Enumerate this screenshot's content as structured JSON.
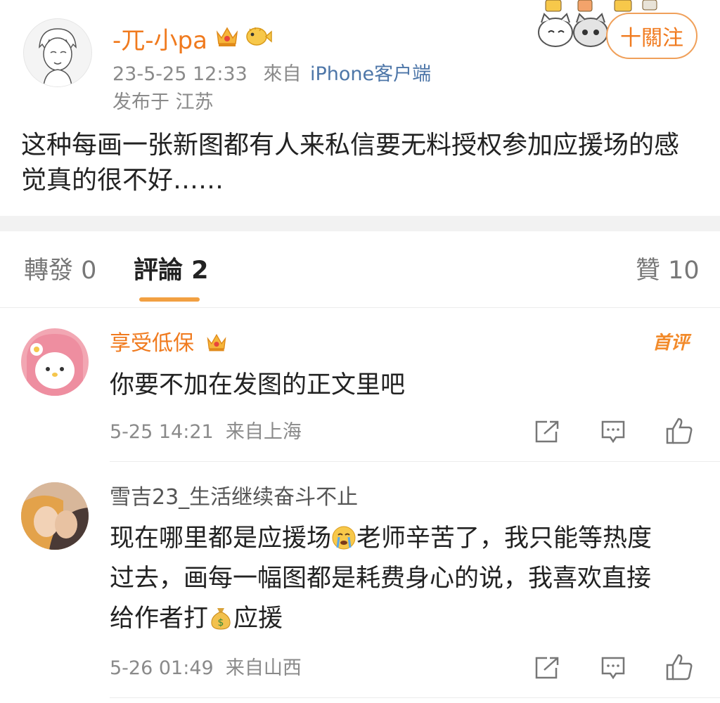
{
  "post": {
    "author": "-兀-小pa",
    "time": "23-5-25 12:33",
    "source_prefix": "來自",
    "source_device": "iPhone客户端",
    "location": "发布于 江苏",
    "follow_label": "十關注",
    "text": "这种每画一张新图都有人来私信要无料授权参加应援场的感觉真的很不好……"
  },
  "tabs": [
    {
      "label": "轉發 0"
    },
    {
      "label": "評論 2"
    },
    {
      "label": "贊 10"
    }
  ],
  "comments": [
    {
      "name": "享受低保",
      "badge": "首评",
      "body": "你要不加在发图的正文里吧",
      "meta": "5-25 14:21  来自上海"
    },
    {
      "name": "雪吉23_生活继续奋斗不止",
      "body_line1_a": "现在哪里都是应援场",
      "body_line1_b": "老师辛苦了，我只能等热度",
      "body_line2": "过去，画每一幅图都是耗费身心的说，我喜欢直接",
      "body_line3_a": "给作者打",
      "body_line3_b": "应援",
      "meta": "5-26 01:49  来自山西"
    }
  ],
  "colors": {
    "accent": "#f07a1e",
    "link": "#4d76a8",
    "muted": "#8a8a8a"
  }
}
